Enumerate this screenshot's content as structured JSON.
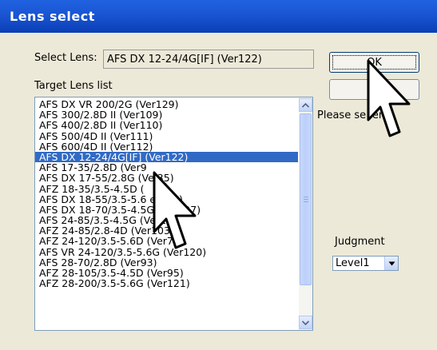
{
  "window": {
    "title": "Lens select"
  },
  "select_lens": {
    "label": "Select Lens:",
    "value": "AFS DX 12-24/4G[IF] (Ver122)"
  },
  "target_list": {
    "label": "Target Lens list",
    "items": [
      "AFS DX VR 200/2G (Ver129)",
      "AFS 300/2.8D II (Ver109)",
      "AFS 400/2.8D II (Ver110)",
      "AFS 500/4D II (Ver111)",
      "AFS 600/4D II (Ver112)",
      "AFS DX 12-24/4G[IF] (Ver122)",
      "AFS 17-35/2.8D (Ver9",
      "AFS DX 17-55/2.8G (Ve   35)",
      "AFZ 18-35/3.5-4.5D (",
      "AFS DX 18-55/3.5-5.6   er140)",
      "AFS DX 18-70/3.5-4.5G (Ver127)",
      "AFS 24-85/3.5-4.5G (Ver1  )",
      "AFZ 24-85/2.8-4D (Ver103)",
      "AFZ 24-120/3.5-5.6D (Ver76)",
      "AFS VR 24-120/3.5-5.6G (Ver120)",
      "AFS 28-70/2.8D (Ver93)",
      "AFZ 28-105/3.5-4.5D (Ver95)",
      "AFZ 28-200/3.5-5.6G (Ver121)"
    ],
    "selected_index": 5
  },
  "buttons": {
    "ok": "OK",
    "cancel": "Ca"
  },
  "status": "Please se   lens.",
  "judgment": {
    "label": "Judgment",
    "value": "Level1"
  },
  "colors": {
    "title_bar": "#1a55d2",
    "selection": "#316ac5",
    "window_bg": "#ece9d8"
  },
  "icons": {
    "pointer": "arrow-cursor-icon",
    "scroll_up": "chevron-up-icon",
    "scroll_down": "chevron-down-icon",
    "dropdown": "chevron-down-icon"
  }
}
